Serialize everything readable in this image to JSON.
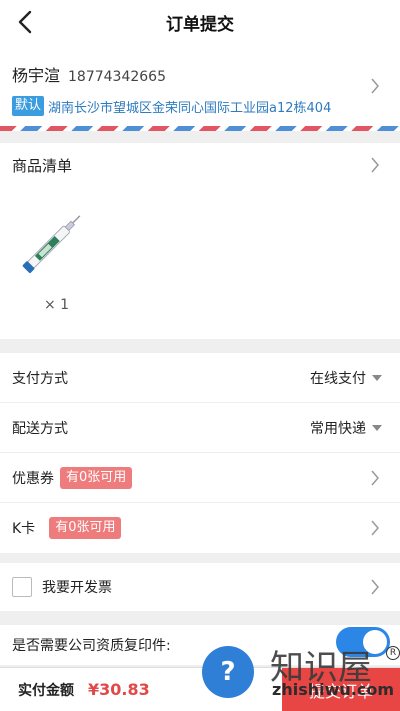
{
  "header": {
    "title": "订单提交",
    "back_icon": "chevron-left-icon"
  },
  "address": {
    "name": "杨宇渲",
    "phone": "18774342665",
    "default_badge": "默认",
    "text": "湖南长沙市望城区金荣同心国际工业园a12栋404"
  },
  "goods": {
    "title": "商品清单",
    "quantity": "× 1",
    "product_icon": "syringe-icon"
  },
  "options": {
    "payment": {
      "label": "支付方式",
      "value": "在线支付"
    },
    "delivery": {
      "label": "配送方式",
      "value": "常用快递"
    },
    "coupon": {
      "label": "优惠券",
      "badge": "有0张可用"
    },
    "kcard": {
      "label": "K卡",
      "badge": "有0张可用"
    }
  },
  "invoice": {
    "label": "我要开发票"
  },
  "qualification": {
    "label": "是否需要公司资质复印件:",
    "toggle_on": true
  },
  "footer": {
    "total_label": "实付金额",
    "total_value": "¥30.83",
    "submit_label": "提交订单"
  },
  "watermark": {
    "text": "知识屋",
    "url": "zhishiwu.com",
    "icon_glyph": "?",
    "reg": "R"
  },
  "colors": {
    "accent_red": "#e84545",
    "price_red": "#e24848",
    "badge_blue": "#3c9ce0",
    "toggle_blue": "#2b86e6",
    "coupon_pink": "#ef7c7c"
  }
}
